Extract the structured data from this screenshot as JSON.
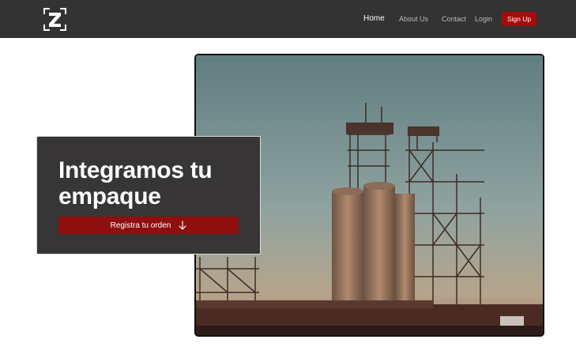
{
  "brand": {
    "logo_icon": "z-logo-icon"
  },
  "nav": {
    "items": [
      {
        "label": "Home"
      },
      {
        "label": "About Us"
      },
      {
        "label": "Contact"
      },
      {
        "label": "Login"
      }
    ],
    "signup_label": "Sign Up"
  },
  "hero": {
    "title": "Integramos tu empaque",
    "cta_label": "Registra tu orden",
    "cta_icon": "arrow-down-icon",
    "image_icon": "industrial-silo-photo"
  },
  "colors": {
    "navbar_bg": "#343333",
    "accent": "#a50b0b",
    "card_bg": "#373535"
  }
}
